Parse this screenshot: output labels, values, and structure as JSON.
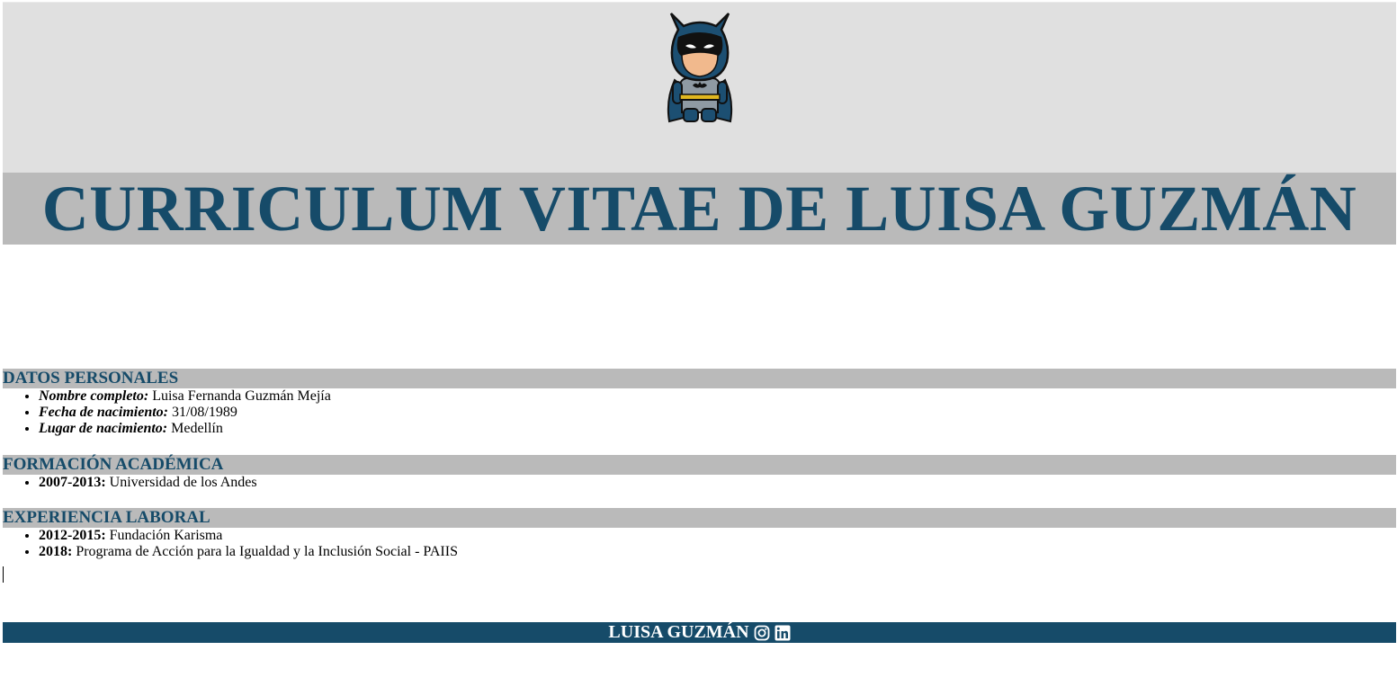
{
  "header": {
    "avatar_icon": "batman-avatar-icon",
    "title": "CURRICULUM VITAE DE LUISA GUZMÁN"
  },
  "sections": {
    "personal": {
      "heading": "DATOS PERSONALES",
      "items": [
        {
          "label": "Nombre completo:",
          "value": "Luisa Fernanda Guzmán Mejía"
        },
        {
          "label": "Fecha de nacimiento:",
          "value": "31/08/1989"
        },
        {
          "label": "Lugar de nacimiento:",
          "value": "Medellín"
        }
      ]
    },
    "education": {
      "heading": "FORMACIÓN ACADÉMICA",
      "items": [
        {
          "label": "2007-2013:",
          "value": "Universidad de los Andes"
        }
      ]
    },
    "work": {
      "heading": "EXPERIENCIA LABORAL",
      "items": [
        {
          "label": "2012-2015:",
          "value": "Fundación Karisma"
        },
        {
          "label": "2018:",
          "value": "Programa de Acción para la Igualdad y la Inclusión Social - PAIIS"
        }
      ]
    }
  },
  "footer": {
    "name": "LUISA GUZMÁN",
    "icons": [
      "instagram-icon",
      "linkedin-icon"
    ]
  },
  "colors": {
    "primary": "#164b69",
    "section_bg": "#bababa",
    "hero_bg": "#e0e0e0"
  }
}
